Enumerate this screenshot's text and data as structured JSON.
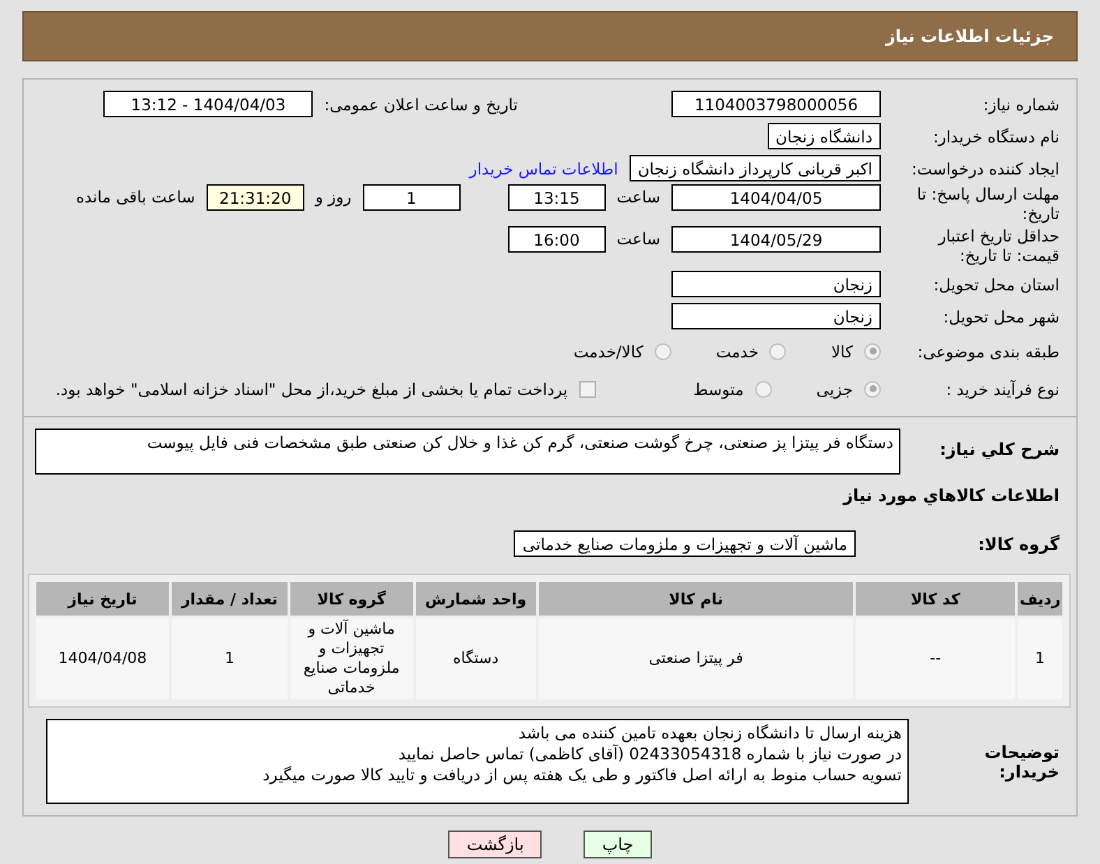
{
  "header": {
    "title": "جزئیات اطلاعات نیاز"
  },
  "need_number": {
    "label": "شماره نیاز:",
    "value": "1104003798000056"
  },
  "announce": {
    "label": "تاریخ و ساعت اعلان عمومی:",
    "value": "1404/04/03 - 13:12"
  },
  "buyer_org": {
    "label": "نام دستگاه خریدار:",
    "value": "دانشگاه زنجان"
  },
  "requester": {
    "label": "ایجاد کننده درخواست:",
    "value": "اکبر قربانی کارپرداز دانشگاه زنجان",
    "link": "اطلاعات تماس خریدار"
  },
  "deadline": {
    "label": "مهلت ارسال پاسخ: تا تاریخ:",
    "date": "1404/04/05",
    "time_label": "ساعت",
    "time": "13:15",
    "days": "1",
    "days_label": "روز و",
    "remaining": "21:31:20",
    "remaining_label": "ساعت باقی مانده"
  },
  "price_validity": {
    "label": "حداقل تاریخ اعتبار قیمت: تا تاریخ:",
    "date": "1404/05/29",
    "time_label": "ساعت",
    "time": "16:00"
  },
  "province": {
    "label": "استان محل تحویل:",
    "value": "زنجان"
  },
  "city": {
    "label": "شهر محل تحویل:",
    "value": "زنجان"
  },
  "category": {
    "label": "طبقه بندی موضوعی:",
    "options": [
      {
        "label": "کالا",
        "selected": true
      },
      {
        "label": "خدمت",
        "selected": false
      },
      {
        "label": "کالا/خدمت",
        "selected": false
      }
    ]
  },
  "process": {
    "label": "نوع فرآیند خرید :",
    "options": [
      {
        "label": "جزیی",
        "selected": true
      },
      {
        "label": "متوسط",
        "selected": false
      }
    ],
    "payment": {
      "checked": false,
      "text": "پرداخت تمام یا بخشی از مبلغ خرید،از محل \"اسناد خزانه اسلامی\" خواهد بود."
    }
  },
  "description": {
    "label": "شرح کلي نياز:",
    "value": "دستگاه فر پیتزا پز صنعتی، چرخ گوشت صنعتی، گرم کن غذا و خلال کن صنعتی طبق مشخصات فنی فایل پیوست"
  },
  "goods_heading": "اطلاعات كالاهاي مورد نياز",
  "goods_group": {
    "label": "گروه کالا:",
    "value": "ماشین آلات و تجهیزات و ملزومات صنایع خدماتی"
  },
  "table": {
    "columns": [
      "ردیف",
      "کد کالا",
      "نام کالا",
      "واحد شمارش",
      "گروه کالا",
      "تعداد / مقدار",
      "تاریخ نیاز"
    ],
    "rows": [
      [
        "1",
        "--",
        "فر پیتزا صنعتی",
        "دستگاه",
        "ماشین آلات و تجهیزات و ملزومات صنایع خدماتی",
        "1",
        "1404/04/08"
      ]
    ]
  },
  "buyer_notes": {
    "label": "توضیحات خریدار:",
    "lines": [
      "هزینه ارسال تا دانشگاه زنجان بعهده تامین کننده می باشد",
      "در صورت نیاز با شماره 02433054318 (آقای کاظمی) تماس حاصل نمایید",
      "تسویه حساب منوط به ارائه اصل فاکتور و طی یک هفته پس از دریافت و تایید کالا صورت میگیرد"
    ]
  },
  "buttons": [
    {
      "label": "چاپ",
      "kind": "print"
    },
    {
      "label": "بازگشت",
      "kind": "back"
    }
  ]
}
